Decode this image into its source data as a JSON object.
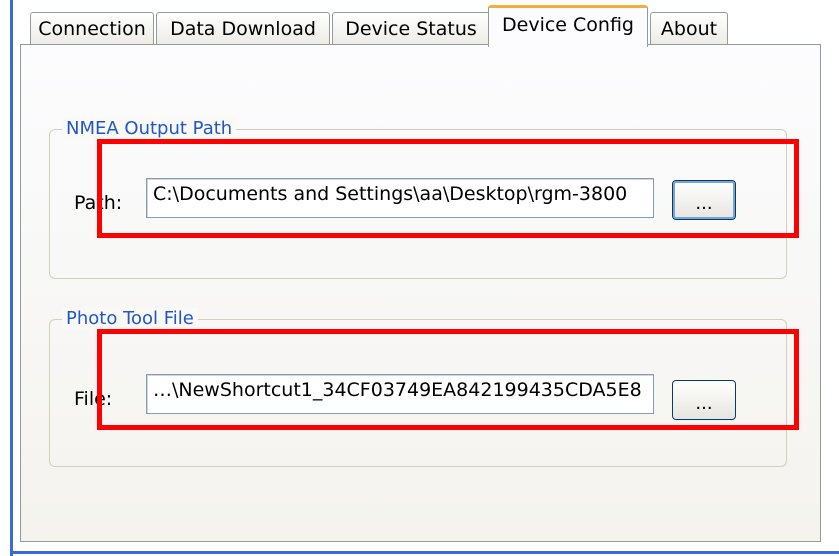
{
  "tabs": [
    {
      "label": "Connection"
    },
    {
      "label": "Data Download"
    },
    {
      "label": "Device Status"
    },
    {
      "label": "Device Config"
    },
    {
      "label": "About"
    }
  ],
  "active_tab": "Device Config",
  "nmea_group": {
    "title": "NMEA Output Path",
    "path_label": "Path:",
    "path_value": "C:\\Documents and Settings\\aa\\Desktop\\rgm-3800",
    "browse_label": "..."
  },
  "photo_group": {
    "title": "Photo Tool File",
    "file_label": "File:",
    "file_value": "…\\NewShortcut1_34CF03749EA842199435CDA5E8",
    "browse_label": "..."
  },
  "colors": {
    "active_tab_accent": "#f3ae3b",
    "group_title": "#1f56c9",
    "annotation_box": "#ff0000"
  }
}
